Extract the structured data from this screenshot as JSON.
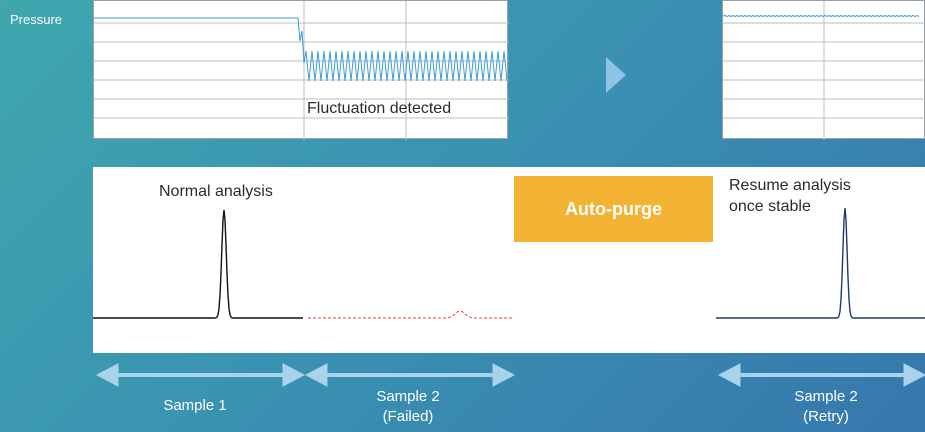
{
  "pressure_label": "Pressure",
  "captions": {
    "fluctuation": "Fluctuation detected",
    "normal": "Normal analysis",
    "resume_line1": "Resume analysis",
    "resume_line2": "once stable"
  },
  "purge_label": "Auto-purge",
  "samples": [
    {
      "line1": "Sample 1",
      "line2": ""
    },
    {
      "line1": "Sample 2",
      "line2": "(Failed)"
    },
    {
      "line1": "Sample 2",
      "line2": "(Retry)"
    }
  ],
  "colors": {
    "pressure_trace": "#3d9ad8",
    "peak_normal": "#111111",
    "peak_failed": "#e53935",
    "peak_retry": "#1f3a6e",
    "purge_box": "#f2b233",
    "arrow": "#a9d3ea"
  }
}
